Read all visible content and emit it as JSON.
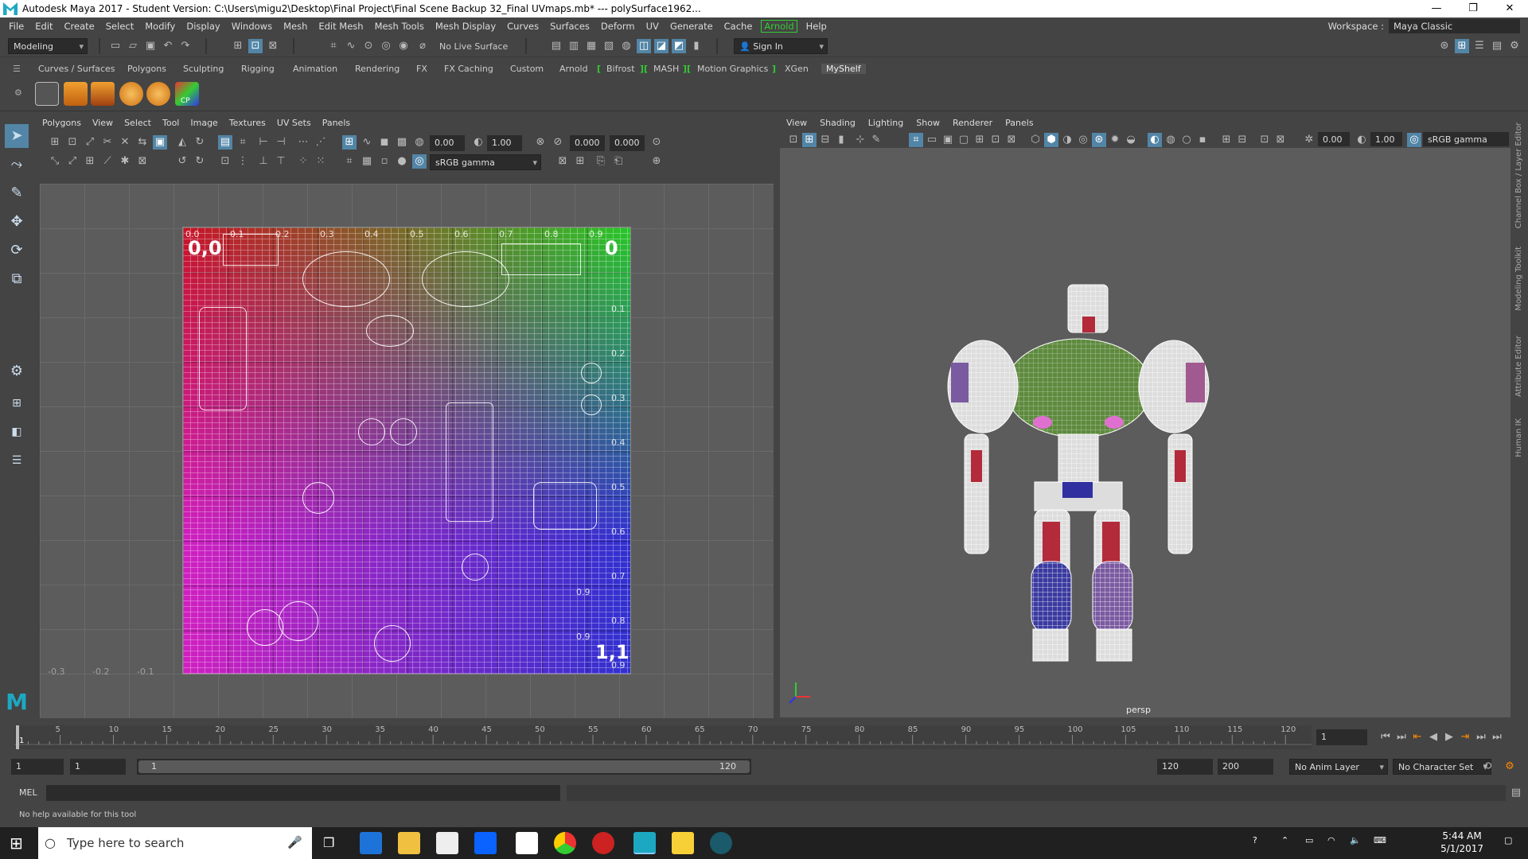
{
  "titlebar": {
    "title": "Autodesk Maya 2017 - Student Version: C:\\Users\\migu2\\Desktop\\Final Project\\Final Scene Backup 32_Final UVmaps.mb*   ---   polySurface1962...",
    "min": "—",
    "max": "❐",
    "close": "✕"
  },
  "menubar": {
    "items": [
      "File",
      "Edit",
      "Create",
      "Select",
      "Modify",
      "Display",
      "Windows",
      "Mesh",
      "Edit Mesh",
      "Mesh Tools",
      "Mesh Display",
      "Curves",
      "Surfaces",
      "Deform",
      "UV",
      "Generate",
      "Cache",
      "Arnold",
      "Help"
    ]
  },
  "workspace": {
    "label": "Workspace :",
    "value": "Maya Classic"
  },
  "statusline": {
    "mode": "Modeling",
    "live_surface": "No Live Surface",
    "sign_in": "Sign In"
  },
  "shelf": {
    "tabs": [
      "Curves / Surfaces",
      "Polygons",
      "Sculpting",
      "Rigging",
      "Animation",
      "Rendering",
      "FX",
      "FX Caching",
      "Custom",
      "Arnold",
      "Bifrost",
      "MASH",
      "Motion Graphics",
      "XGen",
      "MyShelf"
    ],
    "active": "MyShelf",
    "cp_label": "CP"
  },
  "uv_editor": {
    "menu": [
      "Polygons",
      "View",
      "Select",
      "Tool",
      "Image",
      "Textures",
      "UV Sets",
      "Panels"
    ],
    "field_a": "0.00",
    "field_b": "1.00",
    "field_c": "0.000",
    "field_d": "0.000",
    "colorspace": "sRGB gamma",
    "corner_origin": "0,0",
    "corner_end": "1,1",
    "top_ticks": [
      "0.0",
      "0.1",
      "0.2",
      "0.3",
      "0.4",
      "0.5",
      "0.6",
      "0.7",
      "0.8",
      "0.9"
    ],
    "right_ticks": [
      "0.1",
      "0.2",
      "0.3",
      "0.4",
      "0.5",
      "0.6",
      "0.7",
      "0.8",
      "0.9"
    ],
    "outside_ticks": [
      "-0.3",
      "-0.2",
      "-0.1"
    ],
    "top_right_digit": "0",
    "bottom_right_top": "0.9",
    "mid_right_labels": [
      "0.9",
      "0.8"
    ]
  },
  "viewport": {
    "menu": [
      "View",
      "Shading",
      "Lighting",
      "Show",
      "Renderer",
      "Panels"
    ],
    "field_a": "0.00",
    "field_b": "1.00",
    "colorspace": "sRGB gamma",
    "camera": "persp"
  },
  "right_tabs": [
    "Channel Box / Layer Editor",
    "Modeling Toolkit",
    "Attribute Editor",
    "Human IK"
  ],
  "timeline": {
    "ticks": [
      "5",
      "10",
      "15",
      "20",
      "25",
      "30",
      "35",
      "40",
      "45",
      "50",
      "55",
      "60",
      "65",
      "70",
      "75",
      "80",
      "85",
      "90",
      "95",
      "100",
      "105",
      "110",
      "115",
      "120"
    ],
    "current_frame_marker": "1",
    "current_frame": "1",
    "range_start": "1",
    "range_start2": "1",
    "range_slider_start": "1",
    "range_slider_end": "120",
    "range_end": "120",
    "range_end2": "200",
    "anim_layer": "No Anim Layer",
    "character_set": "No Character Set"
  },
  "command": {
    "label": "MEL"
  },
  "helpline": {
    "text": "No help available for this tool"
  },
  "taskbar": {
    "search_placeholder": "Type here to search",
    "time": "5:44 AM",
    "date": "5/1/2017"
  }
}
